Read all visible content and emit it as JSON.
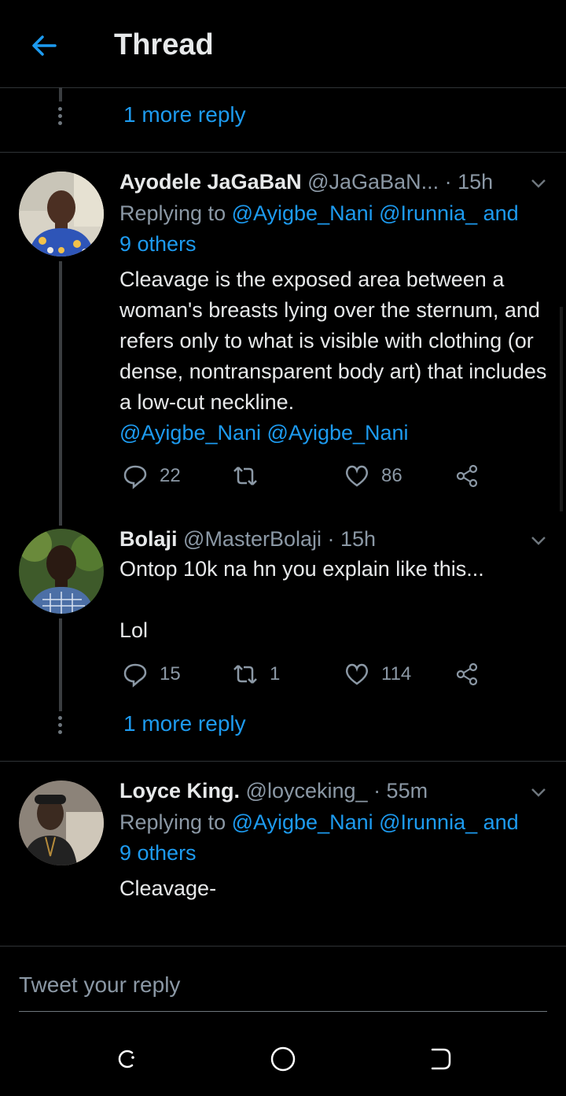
{
  "header": {
    "title": "Thread"
  },
  "threads": {
    "more_reply_top": "1 more reply",
    "more_reply_mid": "1 more reply"
  },
  "tweets": [
    {
      "name": "Ayodele JaGaBaN",
      "handle": "@JaGaBaN...",
      "time": "· 15h",
      "replying_prefix": "Replying to ",
      "replying_mentions": "@Ayigbe_Nani @Irunnia_ and",
      "replying_others": "9 others",
      "text": "Cleavage is the exposed area between a woman's breasts lying over the sternum, and refers only to what is visible with clothing (or dense, nontransparent body art) that includes a low-cut neckline.",
      "text_mentions": "@Ayigbe_Nani @Ayigbe_Nani",
      "replies": "22",
      "retweets": "",
      "likes": "86"
    },
    {
      "name": "Bolaji",
      "handle": "@MasterBolaji",
      "time": "· 15h",
      "text_line1": "Ontop 10k na hn you explain like this...",
      "text_line2": "Lol",
      "replies": "15",
      "retweets": "1",
      "likes": "114"
    },
    {
      "name": "Loyce King.",
      "handle": "@loyceking_",
      "time": "· 55m",
      "replying_prefix": "Replying to ",
      "replying_mentions": "@Ayigbe_Nani @Irunnia_ and",
      "replying_others": "9 others",
      "text": "Cleavage-"
    }
  ],
  "composer": {
    "placeholder": "Tweet your reply"
  },
  "colors": {
    "accent": "#1d9bf0",
    "muted": "#8b98a5",
    "background": "#000000"
  }
}
